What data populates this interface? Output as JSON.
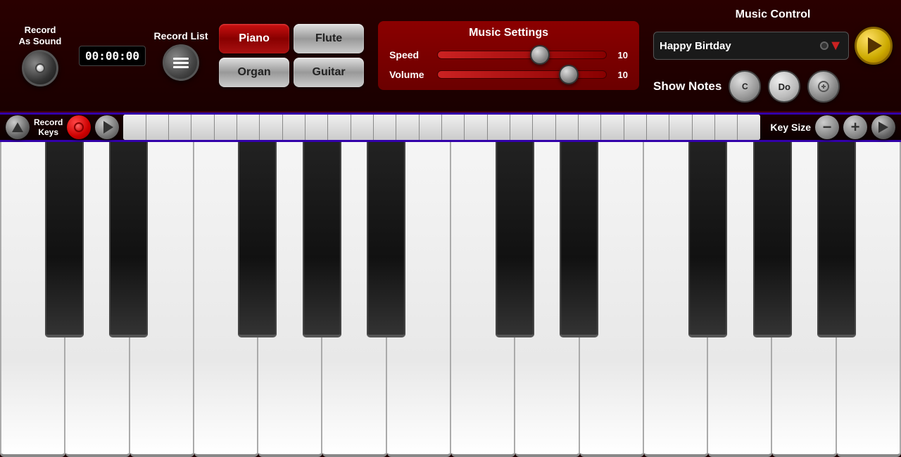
{
  "topBar": {
    "recordAsSound": {
      "line1": "Record",
      "line2": "As Sound"
    },
    "timer": "00:00:00",
    "recordList": {
      "label": "Record List"
    },
    "instruments": [
      {
        "id": "piano",
        "label": "Piano",
        "active": true
      },
      {
        "id": "flute",
        "label": "Flute",
        "active": false
      },
      {
        "id": "organ",
        "label": "Organ",
        "active": false
      },
      {
        "id": "guitar",
        "label": "Guitar",
        "active": false
      }
    ],
    "musicSettings": {
      "title": "Music Settings",
      "speed": {
        "label": "Speed",
        "value": "10",
        "thumbPosition": "60%"
      },
      "volume": {
        "label": "Volume",
        "value": "10",
        "thumbPosition": "78%"
      }
    },
    "musicControl": {
      "title": "Music Control",
      "songName": "Happy Birtday",
      "playButton": "▶",
      "showNotes": {
        "label": "Show Notes",
        "noteC": "C",
        "noteDo": "Do"
      }
    }
  },
  "keysBar": {
    "recordKeysLabel": "Record\nKeys",
    "keySizeLabel": "Key Size"
  },
  "piano": {
    "whiteKeyCount": 14,
    "blackKeyPositions": [
      1,
      2,
      4,
      5,
      6,
      8,
      9,
      11,
      12,
      13
    ]
  }
}
